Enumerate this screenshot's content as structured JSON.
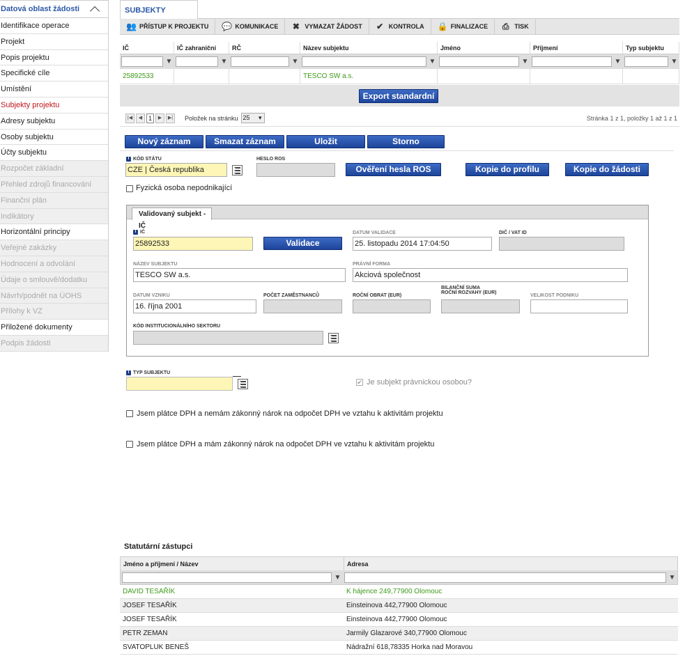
{
  "sidebar": {
    "header": "Datová oblast žádosti",
    "items": [
      {
        "label": "Identifikace operace",
        "state": "normal"
      },
      {
        "label": "Projekt",
        "state": "normal"
      },
      {
        "label": "Popis projektu",
        "state": "normal"
      },
      {
        "label": "Specifické cíle",
        "state": "normal"
      },
      {
        "label": "Umístění",
        "state": "normal"
      },
      {
        "label": "Subjekty projektu",
        "state": "active"
      },
      {
        "label": "Adresy subjektu",
        "state": "normal"
      },
      {
        "label": "Osoby subjektu",
        "state": "normal"
      },
      {
        "label": "Účty subjektu",
        "state": "normal"
      },
      {
        "label": "Rozpočet základní",
        "state": "disabled"
      },
      {
        "label": "Přehled zdrojů financování",
        "state": "disabled"
      },
      {
        "label": "Finanční plán",
        "state": "disabled"
      },
      {
        "label": "Indikátory",
        "state": "disabled"
      },
      {
        "label": "Horizontální principy",
        "state": "normal"
      },
      {
        "label": "Veřejné zakázky",
        "state": "disabled"
      },
      {
        "label": "Hodnocení a odvolání",
        "state": "disabled"
      },
      {
        "label": "Údaje o smlouvě/dodatku",
        "state": "disabled"
      },
      {
        "label": "Návrh/podnět na ÚOHS",
        "state": "disabled"
      },
      {
        "label": "Přílohy k VZ",
        "state": "disabled"
      },
      {
        "label": "Přiložené dokumenty",
        "state": "normal"
      },
      {
        "label": "Podpis žádosti",
        "state": "disabled"
      }
    ]
  },
  "tab": {
    "label": "SUBJEKTY PROJEKTU"
  },
  "toolbar": [
    {
      "label": "PŘÍSTUP K PROJEKTU",
      "icon": "people-icon",
      "glyph": "👥"
    },
    {
      "label": "KOMUNIKACE",
      "icon": "chat-icon",
      "glyph": "💬"
    },
    {
      "label": "VYMAZAT ŽÁDOST",
      "icon": "close-icon",
      "glyph": "✖"
    },
    {
      "label": "KONTROLA",
      "icon": "check-icon",
      "glyph": "✔"
    },
    {
      "label": "FINALIZACE",
      "icon": "lock-icon",
      "glyph": "🔒"
    },
    {
      "label": "TISK",
      "icon": "print-icon",
      "glyph": "⎙"
    }
  ],
  "grid": {
    "columns": [
      "IČ",
      "IČ zahraniční",
      "RČ",
      "Název subjektu",
      "Jméno",
      "Příjmení",
      "Typ subjektu"
    ],
    "rows": [
      [
        "25892533",
        "",
        "",
        "TESCO SW a.s.",
        "",
        "",
        ""
      ]
    ]
  },
  "export_label": "Export standardní",
  "pager": {
    "page": "1",
    "per_page_label": "Položek na stránku",
    "per_page": "25",
    "info": "Stránka 1 z 1, položky 1 až 1 z 1"
  },
  "actions": {
    "new": "Nový záznam",
    "delete": "Smazat záznam",
    "save": "Uložit",
    "cancel": "Storno"
  },
  "form": {
    "kod_statu_label": "KÓD STÁTU",
    "kod_statu_value": "CZE | Česká republika",
    "heslo_ros_label": "HESLO ROS",
    "overeni_label": "Ověření hesla ROS",
    "kopie_profil_label": "Kopie do profilu",
    "kopie_zadost_label": "Kopie do žádosti",
    "fyzicka_label": "Fyzická osoba nepodnikající"
  },
  "validated": {
    "tab_label": "Validovaný subjekt - IČ",
    "ic_label": "IČ",
    "ic_value": "25892533",
    "validace_label": "Validace",
    "datum_validace_label": "DATUM VALIDACE",
    "datum_validace_value": "25. listopadu 2014 17:04:50",
    "dic_label": "DIČ / VAT ID",
    "nazev_label": "NÁZEV SUBJEKTU",
    "nazev_value": "TESCO SW a.s.",
    "pravni_forma_label": "PRÁVNÍ FORMA",
    "pravni_forma_value": "Akciová společnost",
    "datum_vzniku_label": "DATUM VZNIKU",
    "datum_vzniku_value": "16. října 2001",
    "pocet_zam_label": "POČET ZAMĚSTNANCŮ",
    "rocni_obrat_label": "ROČNÍ OBRAT (EUR)",
    "bilancni_label1": "BILANČNÍ SUMA",
    "bilancni_label2": "ROČNÍ ROZVAHY (EUR)",
    "velikost_label": "VELIKOST PODNIKU",
    "kod_inst_label": "KÓD INSTITUCIONÁLNÍHO SEKTORU"
  },
  "typ_subjektu_label": "TYP SUBJEKTU",
  "pravnicka_label": "Je subjekt právnickou osobou?",
  "dph1_label": "Jsem plátce DPH a nemám zákonný nárok na odpočet DPH ve vztahu k aktivitám projektu",
  "dph2_label": "Jsem plátce DPH a mám zákonný nárok na odpočet DPH ve vztahu k aktivitám projektu",
  "statutari": {
    "title": "Statutární zástupci",
    "columns": [
      "Jméno a příjmení / Název",
      "Adresa"
    ],
    "rows": [
      [
        "DAVID TESAŘÍK",
        "K hájence 249,77900 Olomouc"
      ],
      [
        "JOSEF TESAŘÍK",
        "Einsteinova 442,77900 Olomouc"
      ],
      [
        "JOSEF TESAŘÍK",
        "Einsteinova 442,77900 Olomouc"
      ],
      [
        "PETR ZEMAN",
        "Jarmily Glazarové 340,77900 Olomouc"
      ],
      [
        "SVATOPLUK BENEŠ",
        "Nádražní 618,78335 Horka nad Moravou"
      ]
    ]
  },
  "colors": {
    "accent": "#2b58a8",
    "active": "#c0171c",
    "selected": "#3e9a1a",
    "button": "#1d449a"
  }
}
